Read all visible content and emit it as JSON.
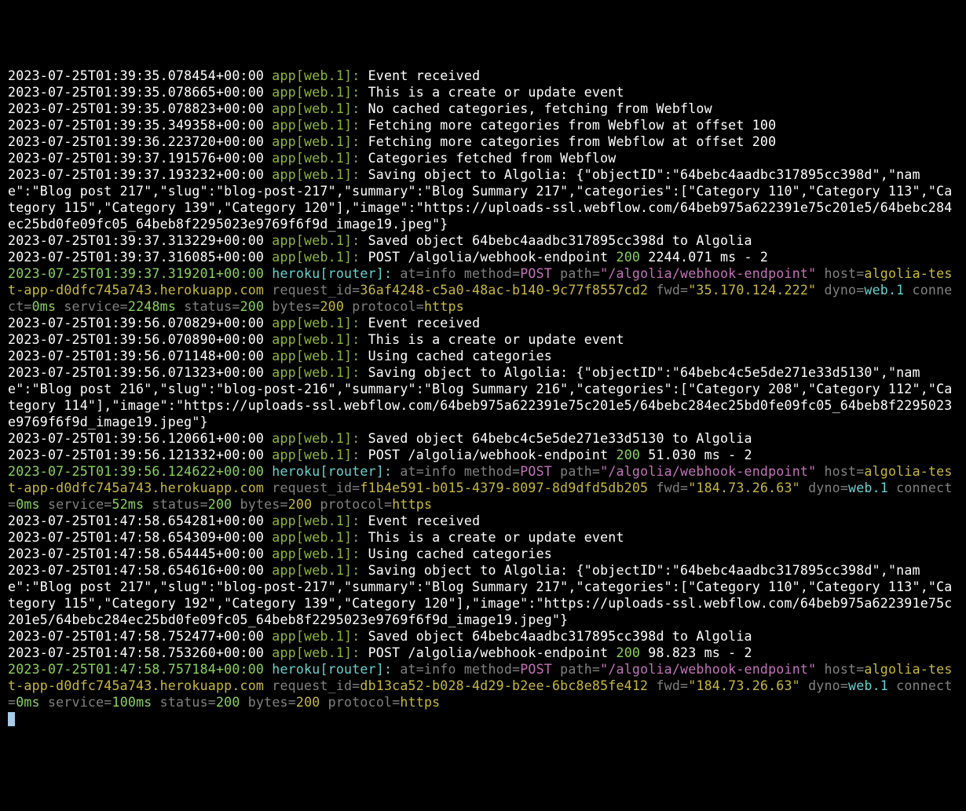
{
  "lines": [
    {
      "type": "app",
      "ts": "2023-07-25T01:39:35.078454+00:00",
      "src": "app[web.1]:",
      "msg": "Event received"
    },
    {
      "type": "app",
      "ts": "2023-07-25T01:39:35.078665+00:00",
      "src": "app[web.1]:",
      "msg": "This is a create or update event"
    },
    {
      "type": "app",
      "ts": "2023-07-25T01:39:35.078823+00:00",
      "src": "app[web.1]:",
      "msg": "No cached categories, fetching from Webflow"
    },
    {
      "type": "app",
      "ts": "2023-07-25T01:39:35.349358+00:00",
      "src": "app[web.1]:",
      "msg": "Fetching more categories from Webflow at offset 100"
    },
    {
      "type": "app",
      "ts": "2023-07-25T01:39:36.223720+00:00",
      "src": "app[web.1]:",
      "msg": "Fetching more categories from Webflow at offset 200"
    },
    {
      "type": "app",
      "ts": "2023-07-25T01:39:37.191576+00:00",
      "src": "app[web.1]:",
      "msg": "Categories fetched from Webflow"
    },
    {
      "type": "app",
      "ts": "2023-07-25T01:39:37.193232+00:00",
      "src": "app[web.1]:",
      "msg": "Saving object to Algolia: {\"objectID\":\"64bebc4aadbc317895cc398d\",\"name\":\"Blog post 217\",\"slug\":\"blog-post-217\",\"summary\":\"Blog Summary 217\",\"categories\":[\"Category 110\",\"Category 113\",\"Category 115\",\"Category 139\",\"Category 120\"],\"image\":\"https://uploads-ssl.webflow.com/64beb975a622391e75c201e5/64bebc284ec25bd0fe09fc05_64beb8f2295023e9769f6f9d_image19.jpeg\"}"
    },
    {
      "type": "app",
      "ts": "2023-07-25T01:39:37.313229+00:00",
      "src": "app[web.1]:",
      "msg": "Saved object 64bebc4aadbc317895cc398d to Algolia"
    },
    {
      "type": "apppost",
      "ts": "2023-07-25T01:39:37.316085+00:00",
      "src": "app[web.1]:",
      "msg_pre": "POST /algolia/webhook-endpoint ",
      "status": "200",
      "msg_post": " 2244.071 ms - 2"
    },
    {
      "type": "router",
      "ts": "2023-07-25T01:39:37.319201+00:00",
      "src": "heroku[router]:",
      "method": "POST",
      "path": "\"/algolia/webhook-endpoint\"",
      "host": "algolia-test-app-d0dfc745a743.herokuapp.com",
      "request_id": "36af4248-c5a0-48ac-b140-9c77f8557cd2",
      "fwd": "\"35.170.124.222\"",
      "dyno": "web.1",
      "connect": "0ms",
      "service": "2248ms",
      "status": "200",
      "bytes": "200",
      "protocol": "https"
    },
    {
      "type": "app",
      "ts": "2023-07-25T01:39:56.070829+00:00",
      "src": "app[web.1]:",
      "msg": "Event received"
    },
    {
      "type": "app",
      "ts": "2023-07-25T01:39:56.070890+00:00",
      "src": "app[web.1]:",
      "msg": "This is a create or update event"
    },
    {
      "type": "app",
      "ts": "2023-07-25T01:39:56.071148+00:00",
      "src": "app[web.1]:",
      "msg": "Using cached categories"
    },
    {
      "type": "app",
      "ts": "2023-07-25T01:39:56.071323+00:00",
      "src": "app[web.1]:",
      "msg": "Saving object to Algolia: {\"objectID\":\"64bebc4c5e5de271e33d5130\",\"name\":\"Blog post 216\",\"slug\":\"blog-post-216\",\"summary\":\"Blog Summary 216\",\"categories\":[\"Category 208\",\"Category 112\",\"Category 114\"],\"image\":\"https://uploads-ssl.webflow.com/64beb975a622391e75c201e5/64bebc284ec25bd0fe09fc05_64beb8f2295023e9769f6f9d_image19.jpeg\"}"
    },
    {
      "type": "app",
      "ts": "2023-07-25T01:39:56.120661+00:00",
      "src": "app[web.1]:",
      "msg": "Saved object 64bebc4c5e5de271e33d5130 to Algolia"
    },
    {
      "type": "apppost",
      "ts": "2023-07-25T01:39:56.121332+00:00",
      "src": "app[web.1]:",
      "msg_pre": "POST /algolia/webhook-endpoint ",
      "status": "200",
      "msg_post": " 51.030 ms - 2"
    },
    {
      "type": "router",
      "ts": "2023-07-25T01:39:56.124622+00:00",
      "src": "heroku[router]:",
      "method": "POST",
      "path": "\"/algolia/webhook-endpoint\"",
      "host": "algolia-test-app-d0dfc745a743.herokuapp.com",
      "request_id": "f1b4e591-b015-4379-8097-8d9dfd5db205",
      "fwd": "\"184.73.26.63\"",
      "dyno": "web.1",
      "connect": "0ms",
      "service": "52ms",
      "status": "200",
      "bytes": "200",
      "protocol": "https"
    },
    {
      "type": "app",
      "ts": "2023-07-25T01:47:58.654281+00:00",
      "src": "app[web.1]:",
      "msg": "Event received"
    },
    {
      "type": "app",
      "ts": "2023-07-25T01:47:58.654309+00:00",
      "src": "app[web.1]:",
      "msg": "This is a create or update event"
    },
    {
      "type": "app",
      "ts": "2023-07-25T01:47:58.654445+00:00",
      "src": "app[web.1]:",
      "msg": "Using cached categories"
    },
    {
      "type": "app",
      "ts": "2023-07-25T01:47:58.654616+00:00",
      "src": "app[web.1]:",
      "msg": "Saving object to Algolia: {\"objectID\":\"64bebc4aadbc317895cc398d\",\"name\":\"Blog post 217\",\"slug\":\"blog-post-217\",\"summary\":\"Blog Summary 217\",\"categories\":[\"Category 110\",\"Category 113\",\"Category 115\",\"Category 192\",\"Category 139\",\"Category 120\"],\"image\":\"https://uploads-ssl.webflow.com/64beb975a622391e75c201e5/64bebc284ec25bd0fe09fc05_64beb8f2295023e9769f6f9d_image19.jpeg\"}"
    },
    {
      "type": "app",
      "ts": "2023-07-25T01:47:58.752477+00:00",
      "src": "app[web.1]:",
      "msg": "Saved object 64bebc4aadbc317895cc398d to Algolia"
    },
    {
      "type": "apppost",
      "ts": "2023-07-25T01:47:58.753260+00:00",
      "src": "app[web.1]:",
      "msg_pre": "POST /algolia/webhook-endpoint ",
      "status": "200",
      "msg_post": " 98.823 ms - 2"
    },
    {
      "type": "router",
      "ts": "2023-07-25T01:47:58.757184+00:00",
      "src": "heroku[router]:",
      "method": "POST",
      "path": "\"/algolia/webhook-endpoint\"",
      "host": "algolia-test-app-d0dfc745a743.herokuapp.com",
      "request_id": "db13ca52-b028-4d29-b2ee-6bc8e85fe412",
      "fwd": "\"184.73.26.63\"",
      "dyno": "web.1",
      "connect": "0ms",
      "service": "100ms",
      "status": "200",
      "bytes": "200",
      "protocol": "https"
    }
  ],
  "labels": {
    "at_info_method": " at=info method=",
    "path": " path=",
    "host": " host=",
    "request_id": " request_id=",
    "fwd": " fwd=",
    "dyno": " dyno=",
    "connect": " connect=",
    "service": " service=",
    "status": " status=",
    "bytes": " bytes=",
    "protocol": " protocol="
  }
}
